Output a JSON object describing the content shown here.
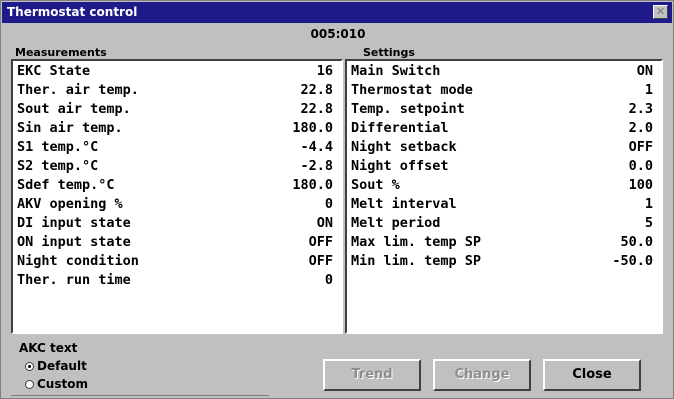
{
  "window": {
    "title": "Thermostat control",
    "close_glyph": "✕"
  },
  "device_id": "005:010",
  "measurements": {
    "label": "Measurements",
    "rows": [
      {
        "label": "EKC State",
        "value": "16"
      },
      {
        "label": "Ther. air temp.",
        "value": "22.8"
      },
      {
        "label": "Sout air temp.",
        "value": "22.8"
      },
      {
        "label": "Sin air temp.",
        "value": "180.0"
      },
      {
        "label": "S1 temp.°C",
        "value": "-4.4"
      },
      {
        "label": "S2 temp.°C",
        "value": "-2.8"
      },
      {
        "label": "Sdef temp.°C",
        "value": "180.0"
      },
      {
        "label": "AKV opening %",
        "value": "0"
      },
      {
        "label": "DI input state",
        "value": "ON"
      },
      {
        "label": "ON input state",
        "value": "OFF"
      },
      {
        "label": "Night condition",
        "value": "OFF"
      },
      {
        "label": "Ther. run time",
        "value": "0"
      }
    ]
  },
  "settings": {
    "label": "Settings",
    "rows": [
      {
        "label": "Main Switch",
        "value": "ON"
      },
      {
        "label": "Thermostat mode",
        "value": "1"
      },
      {
        "label": "Temp. setpoint",
        "value": "2.3"
      },
      {
        "label": "Differential",
        "value": "2.0"
      },
      {
        "label": "Night setback",
        "value": "OFF"
      },
      {
        "label": "Night offset",
        "value": "0.0"
      },
      {
        "label": "Sout %",
        "value": "100"
      },
      {
        "label": "Melt interval",
        "value": "1"
      },
      {
        "label": "Melt period",
        "value": "5"
      },
      {
        "label": "Max lim. temp SP",
        "value": "50.0"
      },
      {
        "label": "Min lim. temp SP",
        "value": "-50.0"
      }
    ]
  },
  "akc_text": {
    "label": "AKC text",
    "options": [
      {
        "label": "Default",
        "selected": true
      },
      {
        "label": "Custom",
        "selected": false
      }
    ]
  },
  "buttons": {
    "trend": "Trend",
    "change": "Change",
    "close": "Close"
  }
}
